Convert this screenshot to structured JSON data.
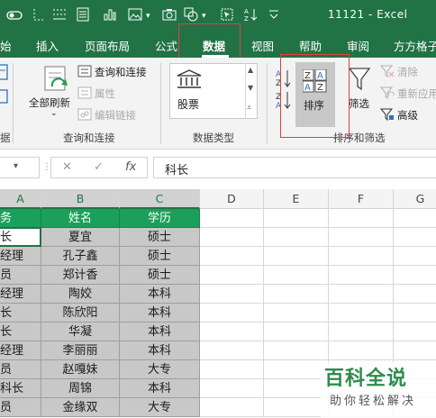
{
  "window": {
    "title": "11121  -  Excel"
  },
  "tabs": [
    {
      "label": "始"
    },
    {
      "label": "插入"
    },
    {
      "label": "页面布局"
    },
    {
      "label": "公式"
    },
    {
      "label": "数据"
    },
    {
      "label": "视图"
    },
    {
      "label": "帮助"
    },
    {
      "label": "审阅"
    },
    {
      "label": "方方格子"
    }
  ],
  "ribbon": {
    "group_left_partial": "据",
    "refresh_all": "全部刷新",
    "query_connect": "查询和连接",
    "properties": "属性",
    "edit_links": "编辑链接",
    "group_query": "查询和连接",
    "stocks": "股票",
    "group_datatypes": "数据类型",
    "sort": "排序",
    "filter": "筛选",
    "clear": "清除",
    "reapply": "重新应用",
    "advanced": "高级",
    "group_sort_filter": "排序和筛选"
  },
  "formula_bar": {
    "cancel": "✕",
    "confirm": "✓",
    "fx": "fx",
    "value": "科长"
  },
  "columns": [
    "A",
    "B",
    "C",
    "D",
    "E",
    "F",
    "G"
  ],
  "table": {
    "headers": [
      "务",
      "姓名",
      "学历"
    ],
    "rows": [
      [
        "长",
        "夏宜",
        "硕士"
      ],
      [
        "经理",
        "孔子鑫",
        "硕士"
      ],
      [
        "员",
        "郑计香",
        "硕士"
      ],
      [
        "经理",
        "陶姣",
        "本科"
      ],
      [
        "长",
        "陈欣阳",
        "本科"
      ],
      [
        "长",
        "华凝",
        "本科"
      ],
      [
        "经理",
        "李丽丽",
        "本科"
      ],
      [
        "员",
        "赵嘎妹",
        "大专"
      ],
      [
        "科长",
        "周锦",
        "本科"
      ],
      [
        "员",
        "金缘双",
        "大专"
      ]
    ]
  },
  "watermark": {
    "big": "百科全说",
    "small": "助你轻松解决"
  },
  "colors": {
    "excel_green": "#217346",
    "header_green": "#1aa05b",
    "highlight_red": "#e0403c"
  }
}
